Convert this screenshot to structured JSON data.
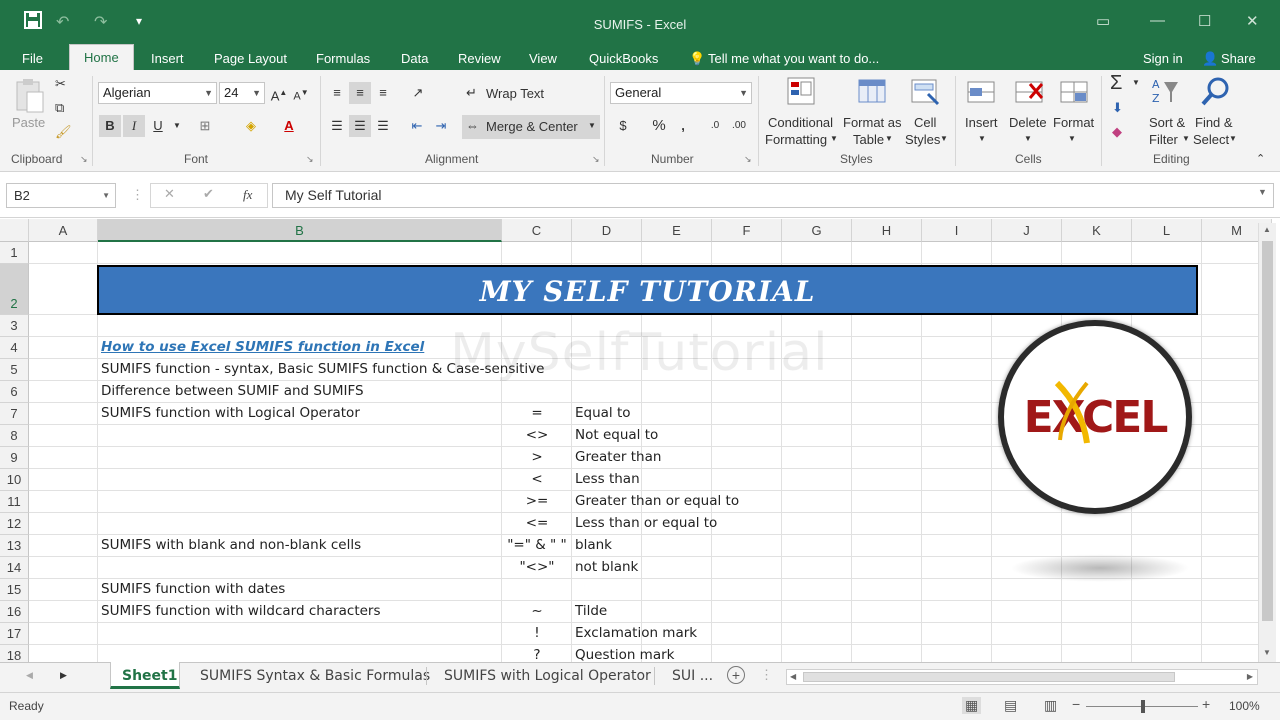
{
  "window": {
    "title": "SUMIFS - Excel",
    "save_icon": "save-icon"
  },
  "menu": {
    "tabs": [
      "File",
      "Home",
      "Insert",
      "Page Layout",
      "Formulas",
      "Data",
      "Review",
      "View",
      "QuickBooks"
    ],
    "tell_me": "Tell me what you want to do...",
    "sign_in": "Sign in",
    "share": "Share"
  },
  "ribbon": {
    "clipboard": {
      "paste": "Paste",
      "label": "Clipboard"
    },
    "font": {
      "name": "Algerian",
      "size": "24",
      "bold": "B",
      "italic": "I",
      "underline": "U",
      "label": "Font"
    },
    "alignment": {
      "wrap": "Wrap Text",
      "merge": "Merge & Center",
      "label": "Alignment"
    },
    "number": {
      "format": "General",
      "currency": "$",
      "percent": "%",
      "comma": ",",
      "label": "Number"
    },
    "styles": {
      "conditional": "Conditional",
      "formatting": "Formatting",
      "format_as": "Format as",
      "table": "Table",
      "cell": "Cell",
      "cell_styles": "Styles",
      "label": "Styles"
    },
    "cells": {
      "insert": "Insert",
      "delete": "Delete",
      "format": "Format",
      "label": "Cells"
    },
    "editing": {
      "sort": "Sort &",
      "filter": "Filter",
      "find": "Find &",
      "select": "Select",
      "label": "Editing"
    }
  },
  "formula_bar": {
    "name_box": "B2",
    "fx": "fx",
    "content": "My Self Tutorial"
  },
  "columns": [
    "A",
    "B",
    "C",
    "D",
    "E",
    "F",
    "G",
    "H",
    "I",
    "J",
    "K",
    "L",
    "M"
  ],
  "rows": [
    "1",
    "2",
    "3",
    "4",
    "5",
    "6",
    "7",
    "8",
    "9",
    "10",
    "11",
    "12",
    "13",
    "14",
    "15",
    "16",
    "17",
    "18"
  ],
  "sheet": {
    "banner": "MY SELF TUTORIAL",
    "link": "How to use Excel SUMIFS function in Excel",
    "watermark": "MySelfTutorial",
    "logo": "EXCEL",
    "b_cells": [
      {
        "row": 5,
        "text": "SUMIFS function - syntax, Basic SUMIFS function  & Case-sensitive"
      },
      {
        "row": 6,
        "text": "Difference between SUMIF and SUMIFS"
      },
      {
        "row": 7,
        "text": "SUMIFS function with Logical Operator"
      },
      {
        "row": 13,
        "text": "SUMIFS with blank and non-blank cells"
      },
      {
        "row": 15,
        "text": "SUMIFS function with dates"
      },
      {
        "row": 16,
        "text": "SUMIFS function with wildcard characters"
      }
    ],
    "operators": [
      {
        "row": 7,
        "op": "=",
        "desc": "Equal to"
      },
      {
        "row": 8,
        "op": "<>",
        "desc": "Not equal to"
      },
      {
        "row": 9,
        "op": ">",
        "desc": "Greater than"
      },
      {
        "row": 10,
        "op": "<",
        "desc": "Less than"
      },
      {
        "row": 11,
        "op": ">=",
        "desc": "Greater than or equal to"
      },
      {
        "row": 12,
        "op": "<=",
        "desc": "Less than or equal to"
      },
      {
        "row": 13,
        "op": "\"=\" & \" \"",
        "desc": "blank"
      },
      {
        "row": 14,
        "op": "\"<>\"",
        "desc": "not blank"
      },
      {
        "row": 16,
        "op": "~",
        "desc": "Tilde"
      },
      {
        "row": 17,
        "op": "!",
        "desc": "Exclamation mark"
      },
      {
        "row": 18,
        "op": "?",
        "desc": "Question mark"
      }
    ]
  },
  "sheet_tabs": [
    "Sheet1",
    "SUMIFS Syntax & Basic Formulas",
    "SUMIFS with Logical Operator",
    "SUI ..."
  ],
  "status": {
    "ready": "Ready",
    "zoom": "100%"
  },
  "colors": {
    "accent": "#217346",
    "banner": "#3a76bd",
    "link": "#2e75b6"
  }
}
